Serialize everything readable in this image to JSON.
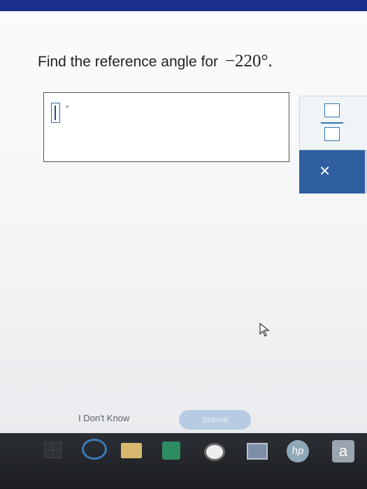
{
  "question": {
    "prompt": "Find the reference angle for",
    "angle": "−220°."
  },
  "answer": {
    "value": "",
    "unit_symbol": "°"
  },
  "palette": {
    "fraction_tool": "fraction-template-icon",
    "clear_label": "×"
  },
  "footer": {
    "dont_know_label": "I Don't Know",
    "submit_label": "Submit"
  },
  "taskbar": {
    "hp_label": "hp",
    "amazon_label": "a",
    "icons": [
      "windows-start-icon",
      "internet-explorer-icon",
      "file-explorer-icon",
      "store-icon",
      "camera-icon",
      "photos-icon",
      "hp-icon",
      "amazon-icon"
    ]
  },
  "colors": {
    "accent": "#2e5ea0",
    "submit_disabled": "#b7cbe2",
    "topbar": "#1c2f8a"
  }
}
